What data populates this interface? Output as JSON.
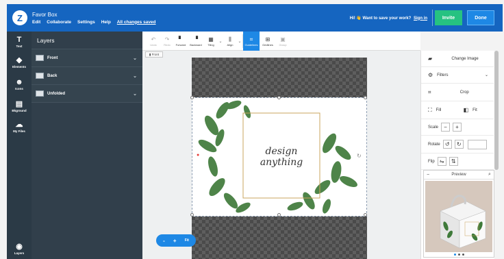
{
  "header": {
    "logo": "Z",
    "title": "Favor Box",
    "menu": [
      "Edit",
      "Collaborate",
      "Settings",
      "Help"
    ],
    "saved_status": "All changes saved",
    "save_prompt": "Hi! 👋 Want to save your work?",
    "signin": "Sign in",
    "invite_label": "Invite",
    "done_label": "Done",
    "colors": {
      "bar": "#1565c0",
      "invite": "#26c281",
      "done": "#1e88e5"
    }
  },
  "sidebar": {
    "items": [
      {
        "label": "Text",
        "glyph": "T",
        "icon": "text-icon"
      },
      {
        "label": "Elements",
        "glyph": "◆",
        "icon": "shapes-icon"
      },
      {
        "label": "Icons",
        "glyph": "☻",
        "icon": "smiley-icon"
      },
      {
        "label": "Bkground",
        "glyph": "▤",
        "icon": "background-icon"
      },
      {
        "label": "My Files",
        "glyph": "☁",
        "icon": "cloud-upload-icon"
      }
    ],
    "bottom": {
      "label": "Layers",
      "glyph": "◉",
      "icon": "layers-icon"
    }
  },
  "layers": {
    "title": "Layers",
    "rows": [
      "Front",
      "Back",
      "Unfolded"
    ]
  },
  "toolbar": {
    "undo": "Undo",
    "redo": "Redo",
    "forward": "Forward",
    "backward": "Backward",
    "tiling": "Tiling",
    "align": "Align",
    "guides": "Guidelines",
    "gridlines": "Gridlines",
    "group": "Group"
  },
  "canvas": {
    "side_tag": "Front",
    "design_text": "design anything"
  },
  "right_panel": {
    "change_image": "Change Image",
    "filters": "Filters",
    "crop": "Crop",
    "fill": "Fill",
    "fit": "Fit",
    "scale": "Scale",
    "rotate": "Rotate",
    "flip": "Flip",
    "preview_title": "Preview"
  },
  "zoom": {
    "minus": "-",
    "plus": "+",
    "fit": "Fit"
  }
}
